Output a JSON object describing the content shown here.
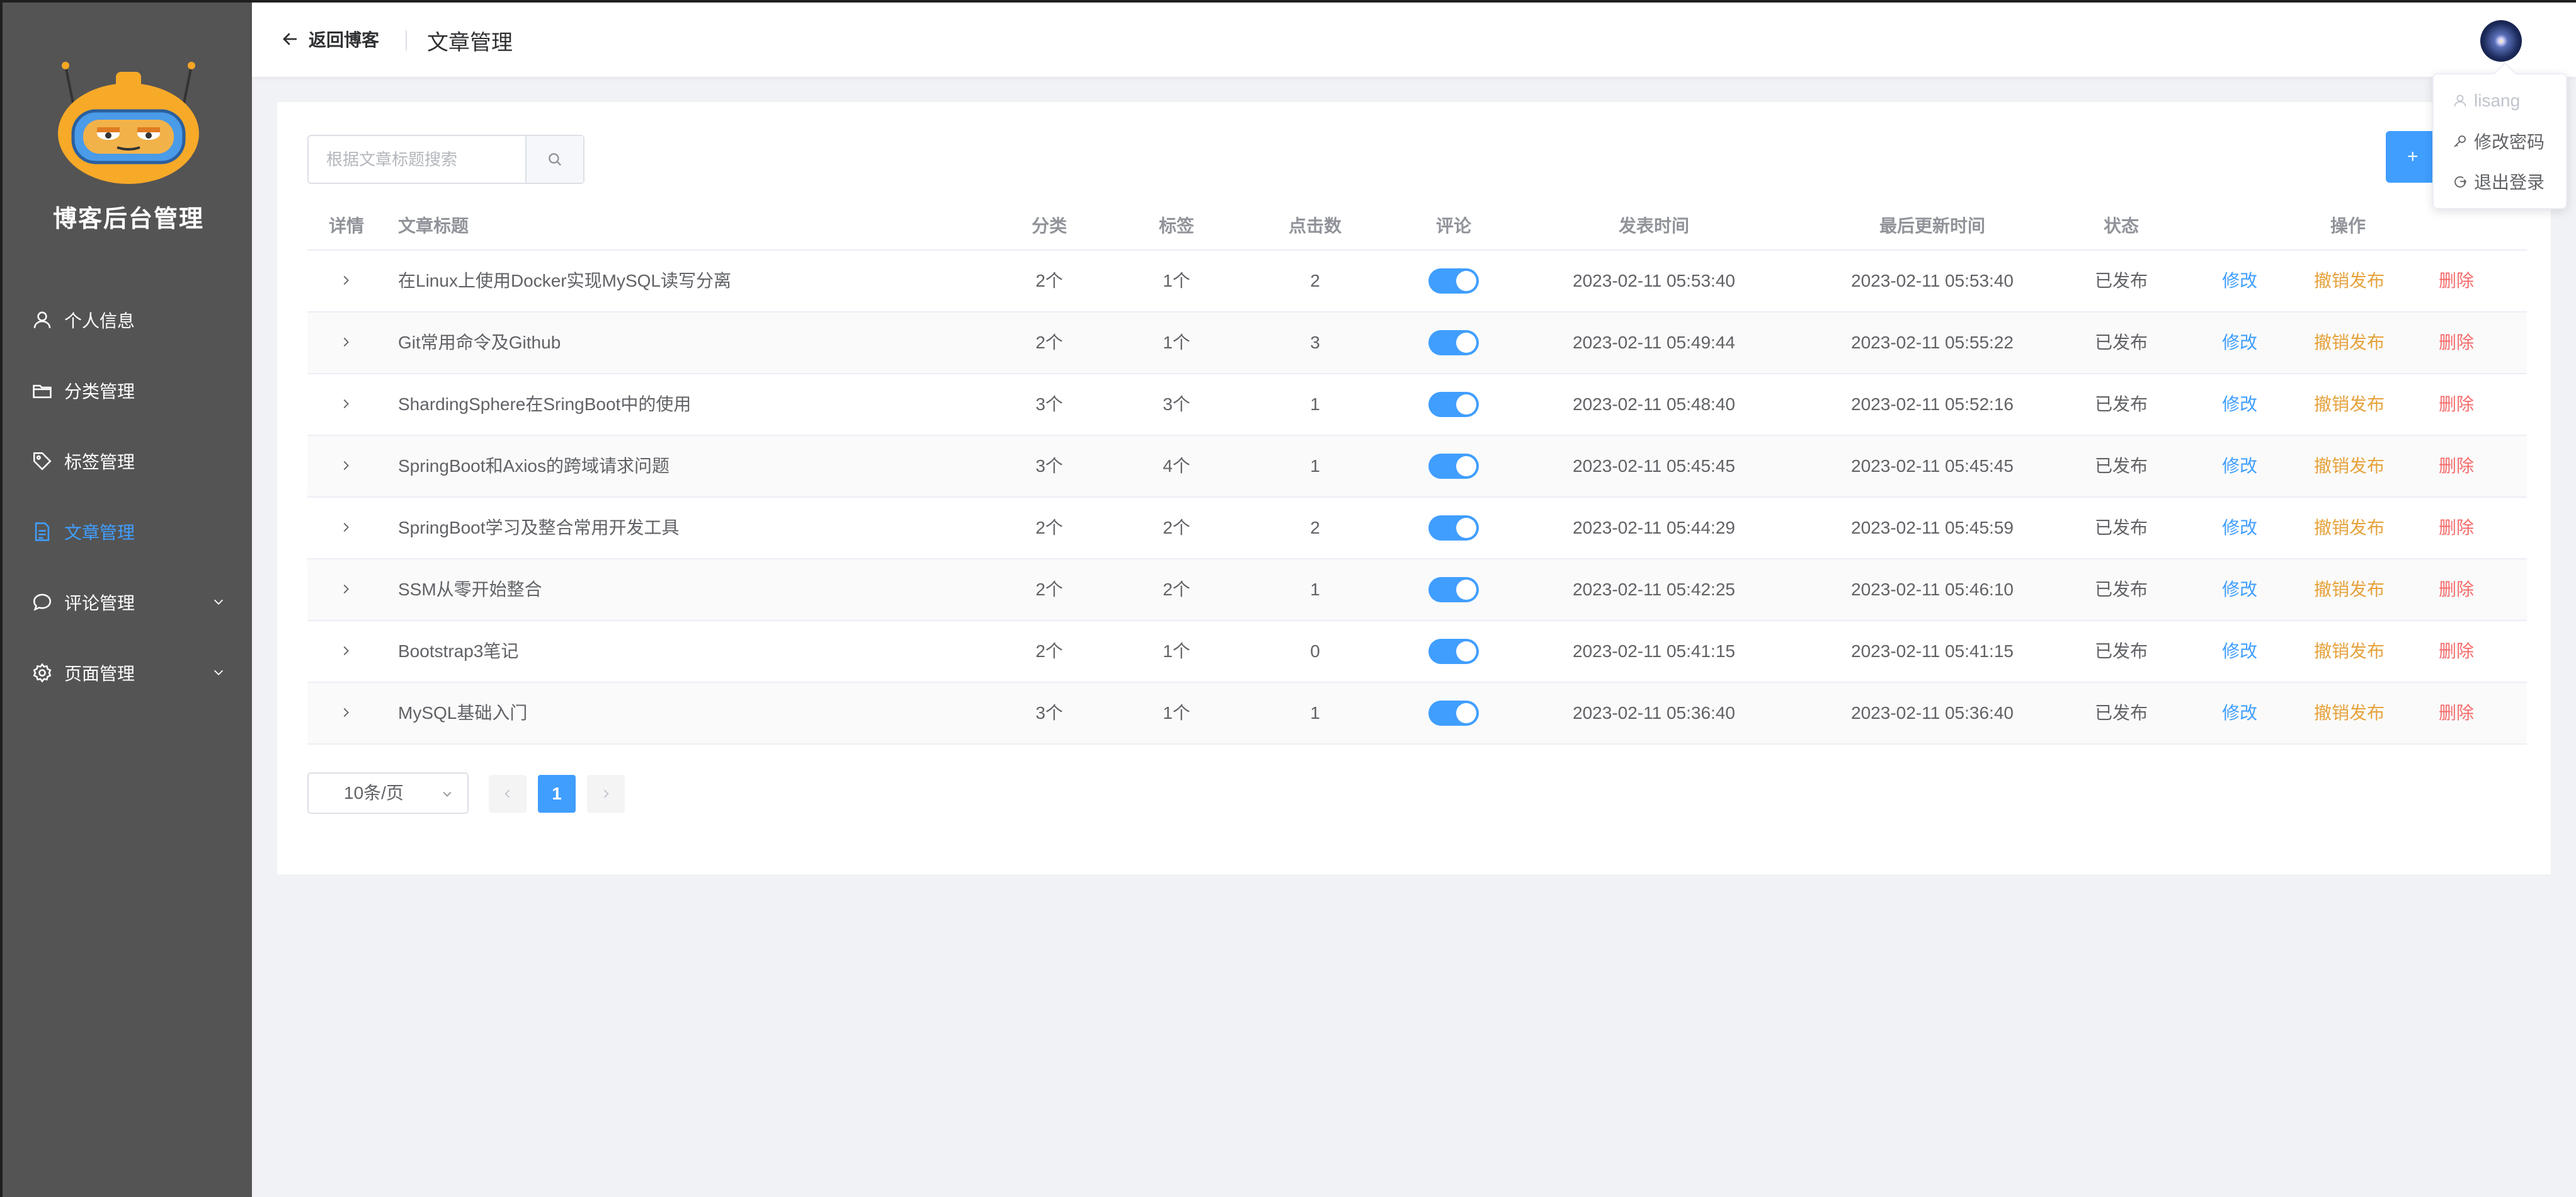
{
  "brand": "博客后台管理",
  "sidebar": {
    "items": [
      {
        "label": "个人信息",
        "icon": "user-icon",
        "active": false,
        "has_submenu": false
      },
      {
        "label": "分类管理",
        "icon": "folder-icon",
        "active": false,
        "has_submenu": false
      },
      {
        "label": "标签管理",
        "icon": "tag-icon",
        "active": false,
        "has_submenu": false
      },
      {
        "label": "文章管理",
        "icon": "document-icon",
        "active": true,
        "has_submenu": false
      },
      {
        "label": "评论管理",
        "icon": "comment-icon",
        "active": false,
        "has_submenu": true
      },
      {
        "label": "页面管理",
        "icon": "gear-icon",
        "active": false,
        "has_submenu": true
      }
    ]
  },
  "header": {
    "back_label": "返回博客",
    "title": "文章管理"
  },
  "user_menu": {
    "username": "lisang",
    "change_password": "修改密码",
    "logout": "退出登录"
  },
  "search": {
    "placeholder": "根据文章标题搜索"
  },
  "add_button_label": "+",
  "table": {
    "columns": [
      "详情",
      "文章标题",
      "分类",
      "标签",
      "点击数",
      "评论",
      "发表时间",
      "最后更新时间",
      "状态",
      "操作"
    ],
    "rows": [
      {
        "title": "在Linux上使用Docker实现MySQL读写分离",
        "category": "2个",
        "tags": "1个",
        "clicks": "2",
        "comment_enabled": true,
        "published": "2023-02-11 05:53:40",
        "updated": "2023-02-11 05:53:40",
        "status": "已发布"
      },
      {
        "title": "Git常用命令及Github",
        "category": "2个",
        "tags": "1个",
        "clicks": "3",
        "comment_enabled": true,
        "published": "2023-02-11 05:49:44",
        "updated": "2023-02-11 05:55:22",
        "status": "已发布"
      },
      {
        "title": "ShardingSphere在SringBoot中的使用",
        "category": "3个",
        "tags": "3个",
        "clicks": "1",
        "comment_enabled": true,
        "published": "2023-02-11 05:48:40",
        "updated": "2023-02-11 05:52:16",
        "status": "已发布"
      },
      {
        "title": "SpringBoot和Axios的跨域请求问题",
        "category": "3个",
        "tags": "4个",
        "clicks": "1",
        "comment_enabled": true,
        "published": "2023-02-11 05:45:45",
        "updated": "2023-02-11 05:45:45",
        "status": "已发布"
      },
      {
        "title": "SpringBoot学习及整合常用开发工具",
        "category": "2个",
        "tags": "2个",
        "clicks": "2",
        "comment_enabled": true,
        "published": "2023-02-11 05:44:29",
        "updated": "2023-02-11 05:45:59",
        "status": "已发布"
      },
      {
        "title": "SSM从零开始整合",
        "category": "2个",
        "tags": "2个",
        "clicks": "1",
        "comment_enabled": true,
        "published": "2023-02-11 05:42:25",
        "updated": "2023-02-11 05:46:10",
        "status": "已发布"
      },
      {
        "title": "Bootstrap3笔记",
        "category": "2个",
        "tags": "1个",
        "clicks": "0",
        "comment_enabled": true,
        "published": "2023-02-11 05:41:15",
        "updated": "2023-02-11 05:41:15",
        "status": "已发布"
      },
      {
        "title": "MySQL基础入门",
        "category": "3个",
        "tags": "1个",
        "clicks": "1",
        "comment_enabled": true,
        "published": "2023-02-11 05:36:40",
        "updated": "2023-02-11 05:36:40",
        "status": "已发布"
      }
    ],
    "actions": {
      "edit": "修改",
      "unpublish": "撤销发布",
      "delete": "删除"
    }
  },
  "pagination": {
    "page_size": "10条/页",
    "current_page": "1",
    "prev_icon": "chevron-left-icon",
    "next_icon": "chevron-right-icon"
  },
  "colors": {
    "primary": "#409eff",
    "warning": "#e6a23c",
    "danger": "#f56c6c",
    "sidebar_bg": "#545454"
  }
}
